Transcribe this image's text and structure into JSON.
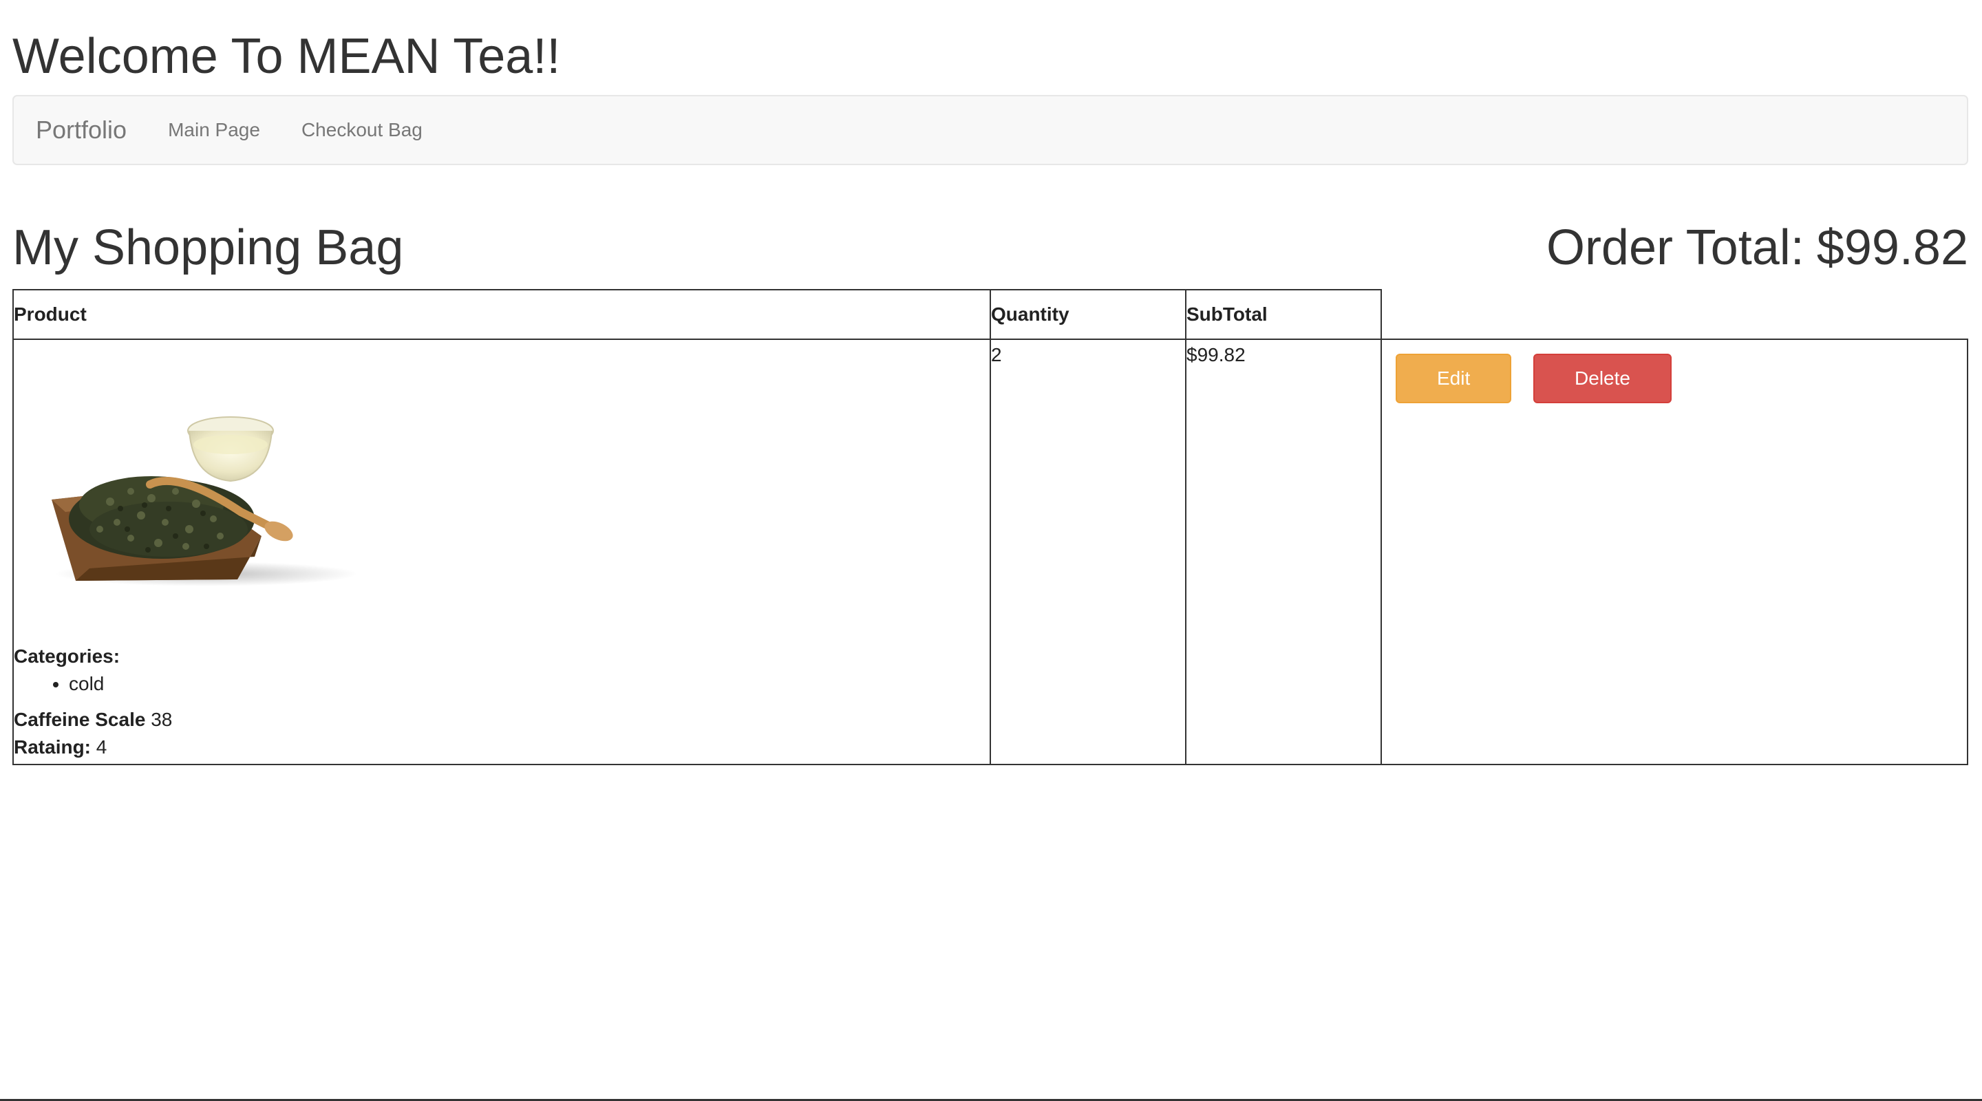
{
  "site": {
    "title": "Welcome To MEAN Tea!!"
  },
  "navbar": {
    "brand": "Portfolio",
    "links": [
      "Main Page",
      "Checkout Bag"
    ]
  },
  "bag": {
    "heading": "My Shopping Bag",
    "order_total_label": "Order Total:",
    "order_total_value": "$99.82"
  },
  "table": {
    "headers": {
      "product": "Product",
      "quantity": "Quantity",
      "subtotal": "SubTotal"
    },
    "rows": [
      {
        "categories_label": "Categories:",
        "categories": [
          "cold"
        ],
        "caffeine_label": "Caffeine Scale",
        "caffeine_value": "38",
        "rating_label": "Rataing:",
        "rating_value": "4",
        "quantity": "2",
        "subtotal": "$99.82",
        "edit_label": "Edit",
        "delete_label": "Delete"
      }
    ]
  },
  "colors": {
    "edit_button": "#f0ad4e",
    "delete_button": "#d9534f",
    "navbar_bg": "#f8f8f8"
  }
}
